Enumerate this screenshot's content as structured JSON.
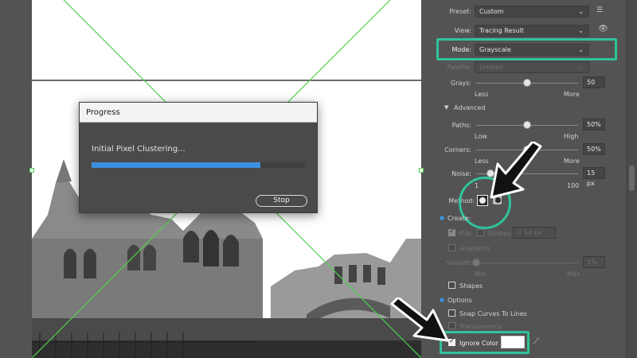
{
  "progress": {
    "title": "Progress",
    "status": "Initial Pixel Clustering...",
    "progress_fraction": 0.79,
    "stop_label": "Stop"
  },
  "panel": {
    "preset_label": "Preset:",
    "preset_value": "Custom",
    "view_label": "View:",
    "view_value": "Tracing Result",
    "mode_label": "Mode:",
    "mode_value": "Grayscale",
    "palette_label": "Palette:",
    "palette_value": "Limited",
    "grays": {
      "label": "Grays:",
      "value": "50",
      "min_label": "Less",
      "max_label": "More",
      "level": 0.5
    },
    "advanced_label": "Advanced",
    "paths": {
      "label": "Paths:",
      "value": "50%",
      "min_label": "Low",
      "max_label": "High",
      "level": 0.5
    },
    "corners": {
      "label": "Corners:",
      "value": "50%",
      "min_label": "Less",
      "max_label": "More",
      "level": 0.5
    },
    "noise": {
      "label": "Noise:",
      "value": "15 px",
      "min_label": "1",
      "max_label": "100",
      "level": 0.14
    },
    "method_label": "Method:",
    "create_label": "Create:",
    "fills_label": "Fills",
    "strokes_label": "Strokes",
    "stroke_value": "10 px",
    "gradients_label": "Gradients",
    "smoothness": {
      "label": "Smooth:",
      "value": "1%",
      "min_label": "Min",
      "max_label": "Max",
      "level": 0.0
    },
    "shapes_label": "Shapes",
    "options_label": "Options",
    "snap_label": "Snap Curves To Lines",
    "transparency_label": "Transparency",
    "ignore_color_label": "Ignore Color",
    "ignore_color_checked": true,
    "ignore_color_swatch": "#ffffff"
  },
  "colors": {
    "highlight": "#2fc29a",
    "progress": "#3d8fe0",
    "guide": "#4dd34d"
  }
}
